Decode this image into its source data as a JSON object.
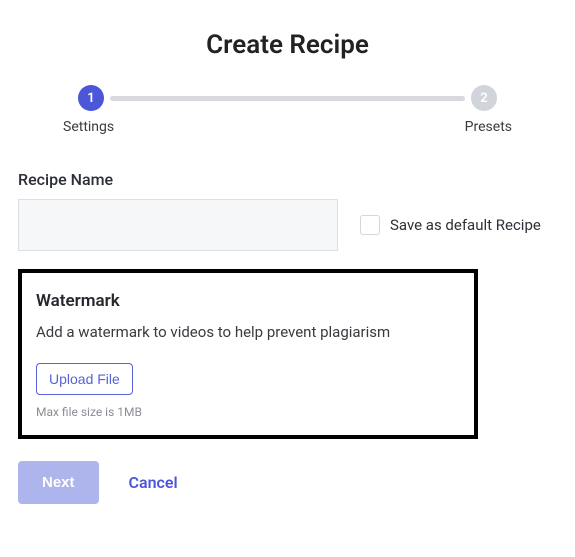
{
  "title": "Create Recipe",
  "stepper": {
    "steps": [
      {
        "num": "1",
        "label": "Settings"
      },
      {
        "num": "2",
        "label": "Presets"
      }
    ]
  },
  "recipeName": {
    "label": "Recipe Name",
    "value": "",
    "saveDefaultLabel": "Save as default Recipe"
  },
  "watermark": {
    "title": "Watermark",
    "description": "Add a watermark to videos to help prevent plagiarism",
    "uploadLabel": "Upload File",
    "note": "Max file size is 1MB"
  },
  "actions": {
    "next": "Next",
    "cancel": "Cancel"
  }
}
